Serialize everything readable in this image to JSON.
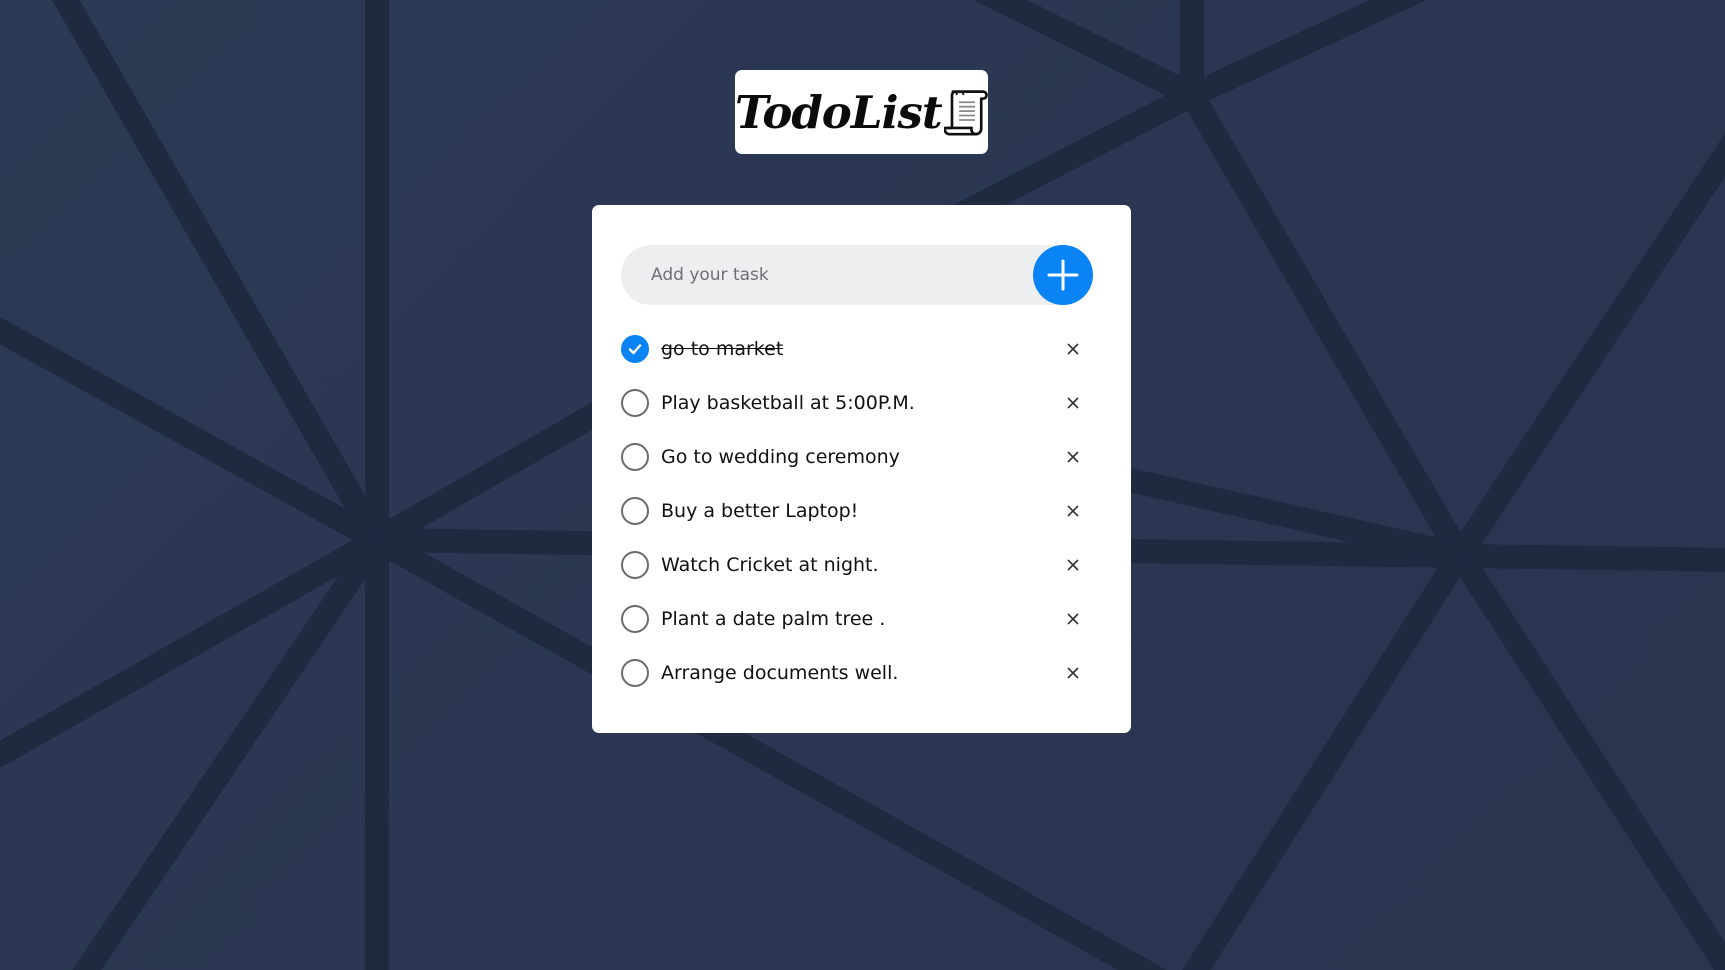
{
  "app": {
    "logo_text": "TodoList",
    "logo_icon": "scroll-icon"
  },
  "input": {
    "placeholder": "Add your task",
    "value": "",
    "add_icon": "plus-icon"
  },
  "tasks": [
    {
      "label": "go to market",
      "done": true
    },
    {
      "label": "Play basketball at 5:00P.M.",
      "done": false
    },
    {
      "label": "Go to wedding ceremony",
      "done": false
    },
    {
      "label": "Buy a better Laptop!",
      "done": false
    },
    {
      "label": "Watch Cricket at night.",
      "done": false
    },
    {
      "label": "Plant a date palm tree .",
      "done": false
    },
    {
      "label": "Arrange documents well.",
      "done": false
    }
  ],
  "colors": {
    "accent": "#0a84f5",
    "background": "#2d3a55",
    "card": "#ffffff",
    "input_bg": "#edeef0"
  },
  "icons": {
    "check": "check-icon",
    "remove": "close-icon"
  }
}
